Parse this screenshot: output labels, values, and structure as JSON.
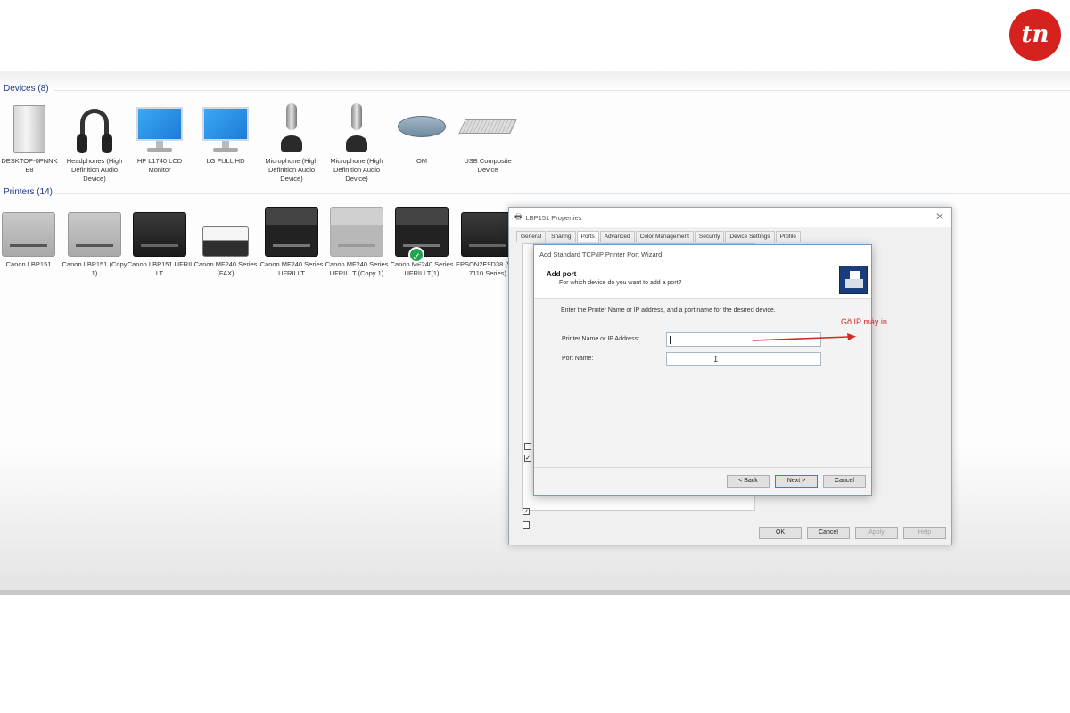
{
  "brand": {
    "logo_text": "tn",
    "logo_color": "#d6221f"
  },
  "devices_section": {
    "title": "Devices (8)",
    "items": [
      {
        "label": "DESKTOP-0PNNK E8",
        "icon": "computer-tower-icon"
      },
      {
        "label": "Headphones (High Definition Audio Device)",
        "icon": "headphones-icon"
      },
      {
        "label": "HP L1740 LCD Monitor",
        "icon": "monitor-icon"
      },
      {
        "label": "LG FULL HD",
        "icon": "monitor-icon"
      },
      {
        "label": "Microphone (High Definition Audio Device)",
        "icon": "microphone-icon"
      },
      {
        "label": "Microphone (High Definition Audio Device)",
        "icon": "microphone-icon"
      },
      {
        "label": "OM",
        "icon": "mouse-icon"
      },
      {
        "label": "USB Composite Device",
        "icon": "keyboard-icon"
      }
    ]
  },
  "printers_section": {
    "title": "Printers (14)",
    "items": [
      {
        "label": "Canon LBP151",
        "icon": "printer-grey-icon"
      },
      {
        "label": "Canon LBP151 (Copy 1)",
        "icon": "printer-grey-icon"
      },
      {
        "label": "Canon LBP151 UFRII LT",
        "icon": "printer-black-icon"
      },
      {
        "label": "Canon MF240 Series (FAX)",
        "icon": "fax-icon"
      },
      {
        "label": "Canon MF240 Series UFRII LT",
        "icon": "mfp-black-icon"
      },
      {
        "label": "Canon MF240 Series UFRII LT (Copy 1)",
        "icon": "mfp-grey-icon"
      },
      {
        "label": "Canon MF240 Series UFRII LT(1)",
        "icon": "mfp-black-icon",
        "default": true
      },
      {
        "label": "EPSON2E9D38 (WF-7110 Series)",
        "icon": "printer-black-icon"
      }
    ]
  },
  "properties_dialog": {
    "title": "LBP151 Properties",
    "tabs": [
      "General",
      "Sharing",
      "Ports",
      "Advanced",
      "Color Management",
      "Security",
      "Device Settings",
      "Profile"
    ],
    "active_tab": "Ports",
    "buttons": {
      "ok": "OK",
      "cancel": "Cancel",
      "apply": "Apply",
      "help": "Help"
    }
  },
  "wizard": {
    "title": "Add Standard TCP/IP Printer Port Wizard",
    "heading": "Add port",
    "subheading": "For which device do you want to add a port?",
    "instruction": "Enter the Printer Name or IP address, and a port name for the desired device.",
    "fields": {
      "ip_label": "Printer Name or IP Address:",
      "ip_value": "",
      "port_label": "Port Name:",
      "port_value": ""
    },
    "buttons": {
      "back": "< Back",
      "next": "Next >",
      "cancel": "Cancel"
    }
  },
  "annotation": {
    "text": "Gõ IP máy in",
    "color": "#d62828"
  }
}
